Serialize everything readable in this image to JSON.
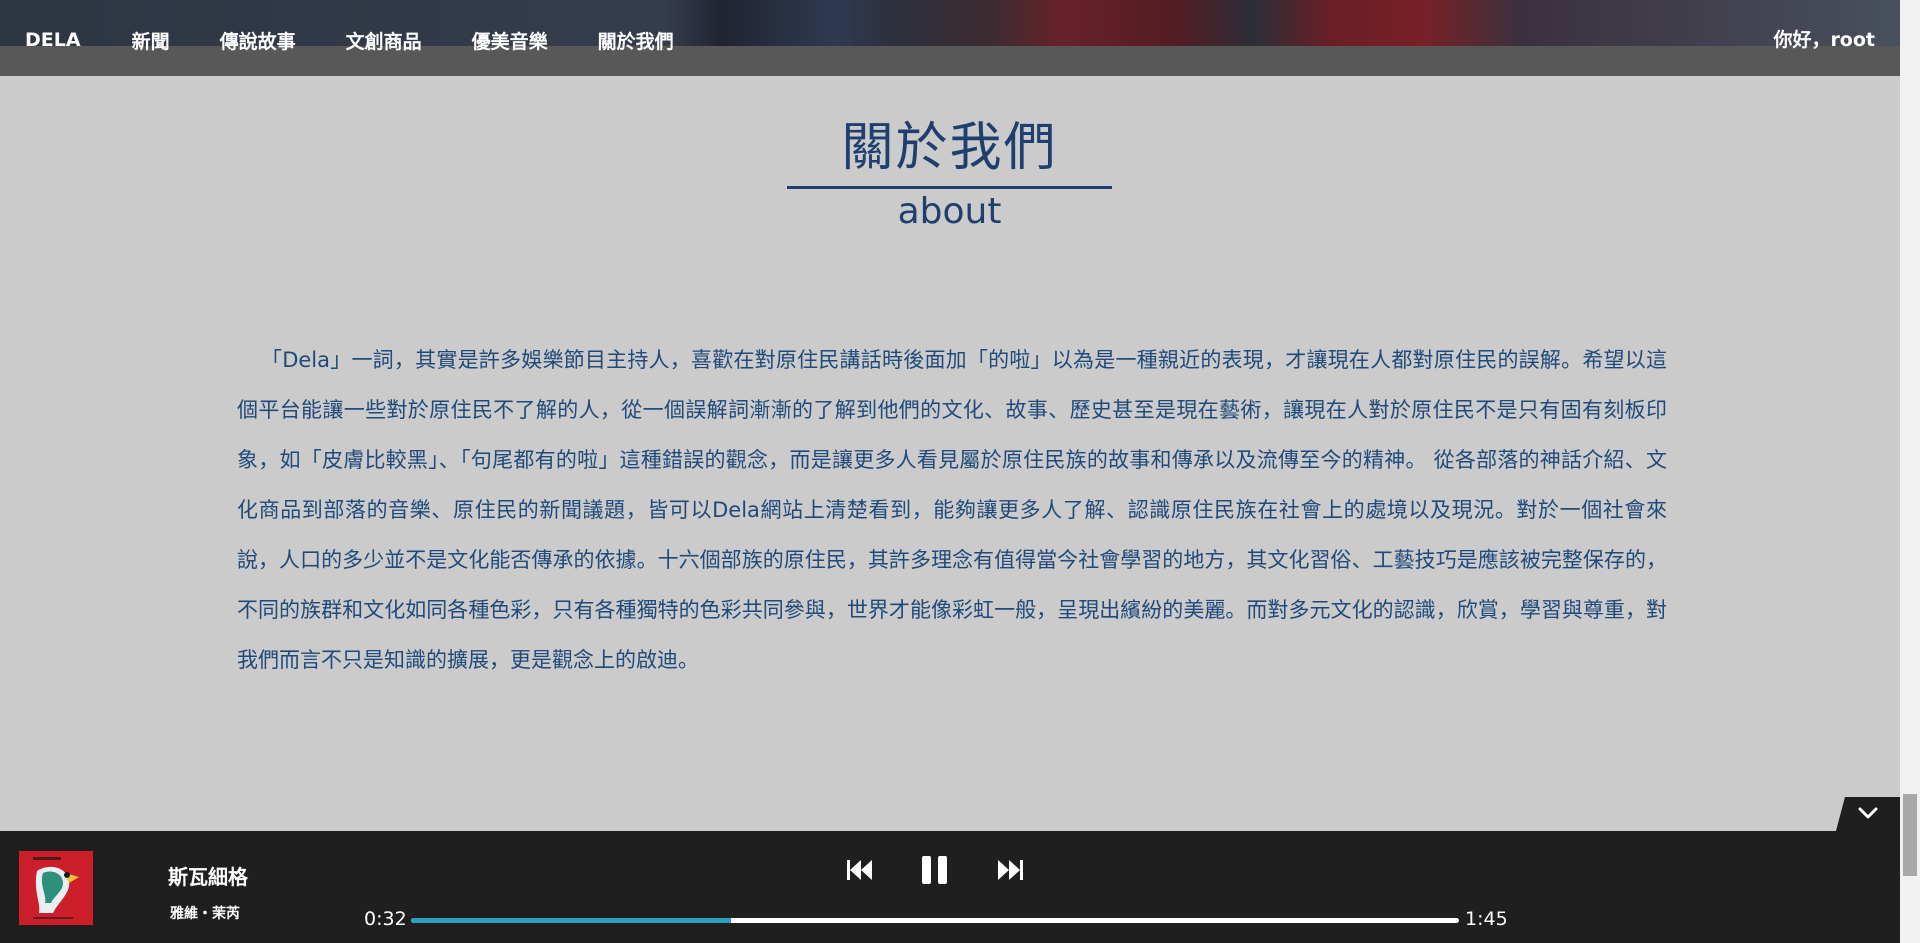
{
  "nav": {
    "items": [
      "DELA",
      "新聞",
      "傳說故事",
      "文創商品",
      "優美音樂",
      "關於我們"
    ],
    "greeting": "你好，root"
  },
  "about": {
    "title": "關於我們",
    "subtitle": "about",
    "paragraph": "「Dela」一詞，其實是許多娛樂節目主持人，喜歡在對原住民講話時後面加「的啦」以為是一種親近的表現，才讓現在人都對原住民的誤解。希望以這個平台能讓一些對於原住民不了解的人，從一個誤解詞漸漸的了解到他們的文化、故事、歷史甚至是現在藝術，讓現在人對於原住民不是只有固有刻板印象，如「皮膚比較黑」、「句尾都有的啦」這種錯誤的觀念，而是讓更多人看見屬於原住民族的故事和傳承以及流傳至今的精神。 從各部落的神話介紹、文化商品到部落的音樂、原住民的新聞議題，皆可以Dela網站上清楚看到，能夠讓更多人了解、認識原住民族在社會上的處境以及現況。對於一個社會來說，人口的多少並不是文化能否傳承的依據。十六個部族的原住民，其許多理念有值得當今社會學習的地方，其文化習俗、工藝技巧是應該被完整保存的，不同的族群和文化如同各種色彩，只有各種獨特的色彩共同參與，世界才能像彩虹一般，呈現出繽紛的美麗。而對多元文化的認識，欣賞，學習與尊重，對我們而言不只是知識的擴展，更是觀念上的啟迪。"
  },
  "player": {
    "song_title": "斯瓦細格",
    "artist": "雅維・茉芮",
    "current_time": "0:32",
    "total_time": "1:45",
    "progress_fraction": 0.305,
    "accent_color": "#2a9fc0",
    "icons": {
      "prev": "skip-previous-icon",
      "pause": "pause-icon",
      "next": "skip-next-icon",
      "collapse": "chevron-down-icon"
    }
  }
}
